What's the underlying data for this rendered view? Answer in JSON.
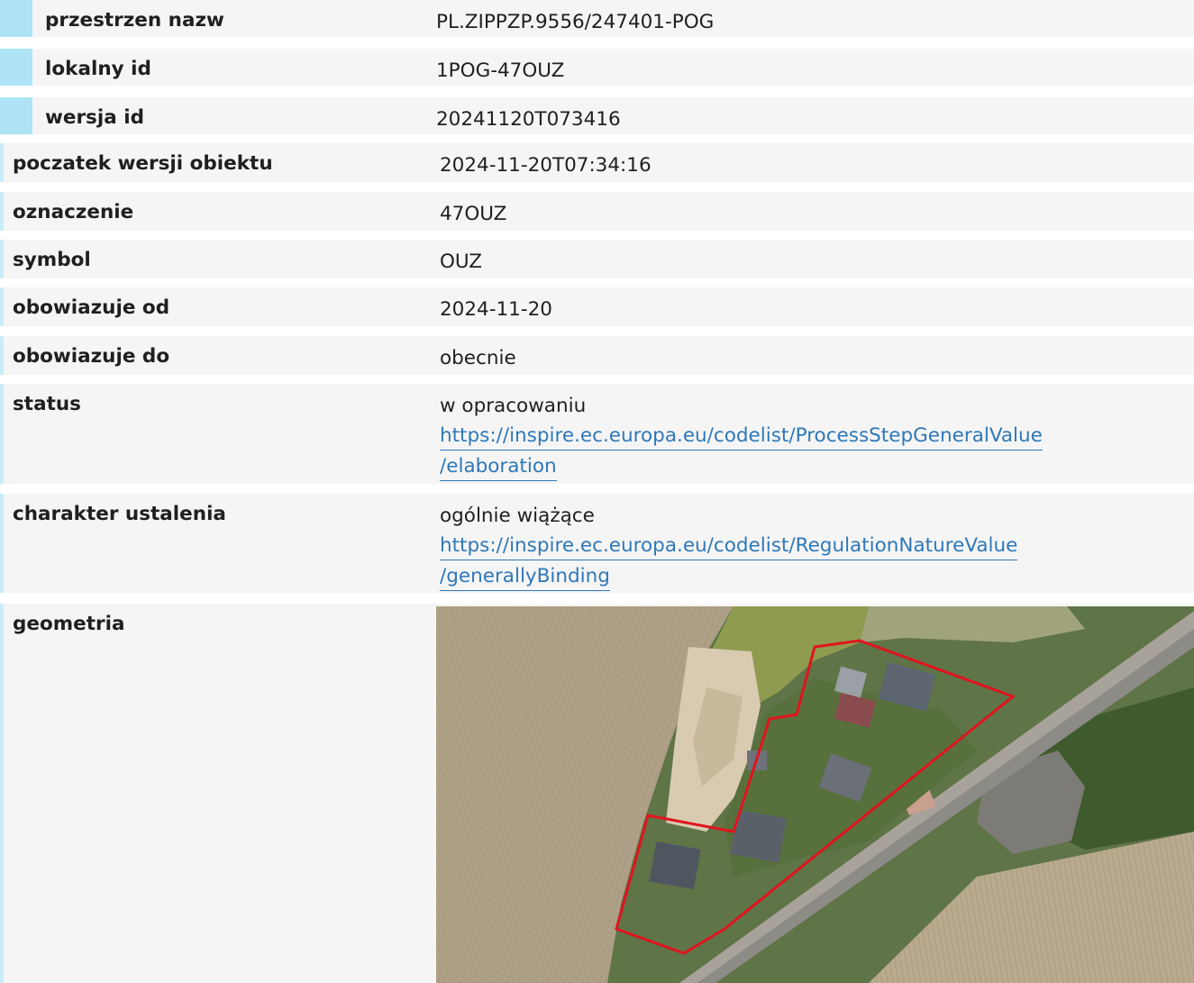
{
  "rows": [
    {
      "label": "przestrzen nazw",
      "value": "PL.ZIPPZP.9556/247401-POG"
    },
    {
      "label": "lokalny id",
      "value": "1POG-47OUZ"
    },
    {
      "label": "wersja id",
      "value": "20241120T073416"
    },
    {
      "label": "poczatek wersji obiektu",
      "value": "2024-11-20T07:34:16"
    },
    {
      "label": "oznaczenie",
      "value": "47OUZ"
    },
    {
      "label": "symbol",
      "value": "OUZ"
    },
    {
      "label": "obowiazuje od",
      "value": "2024-11-20"
    },
    {
      "label": "obowiazuje do",
      "value": "obecnie"
    },
    {
      "label": "status",
      "value": "w opracowaniu",
      "link_line1": "https://inspire.ec.europa.eu/codelist/ProcessStepGeneralValue",
      "link_line2": "/elaboration"
    },
    {
      "label": "charakter ustalenia",
      "value": "ogólnie wiążące",
      "link_line1": "https://inspire.ec.europa.eu/codelist/RegulationNatureValue",
      "link_line2": "/generallyBinding"
    },
    {
      "label": "geometria"
    }
  ],
  "colors": {
    "row_background": "#f5f5f5",
    "sub_marker": "#aee4f6",
    "link": "#2e78b8",
    "boundary": "#e0141e"
  },
  "icons": {
    "map": "aerial-map-image"
  }
}
